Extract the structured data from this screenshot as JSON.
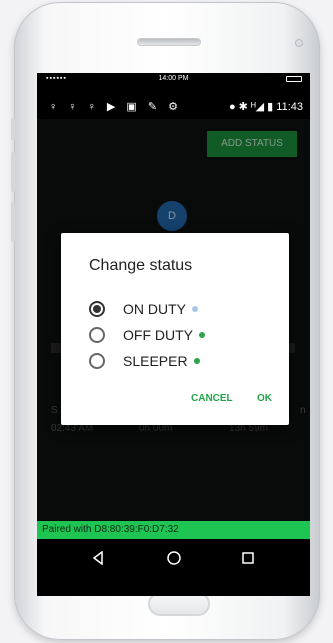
{
  "system_bar": {
    "signal": "▪▪▪▪▪▪",
    "time": "14:00 PM"
  },
  "status_bar": {
    "left_icons": "♀ ♀ ♀ ▶ ▣ ✎ ⚙",
    "right_text": "● ✱ ᴴ◢ ▮ 11:43"
  },
  "app": {
    "add_status_label": "ADD STATUS",
    "avatar_letter": "D",
    "bg_text_1": "S",
    "bg_time_1": "02:43 AM",
    "bg_time_2": "0h 00m",
    "bg_time_3": "13h 59m",
    "bg_text_right": "n"
  },
  "dialog": {
    "title": "Change status",
    "options": [
      {
        "label": "ON DUTY",
        "selected": true,
        "dot_color": "#a8c9e6"
      },
      {
        "label": "OFF DUTY",
        "selected": false,
        "dot_color": "#2aa34a"
      },
      {
        "label": "SLEEPER",
        "selected": false,
        "dot_color": "#2aa34a"
      }
    ],
    "cancel_label": "CANCEL",
    "ok_label": "OK"
  },
  "paired_text": "Paired with D8:80:39:F0:D7:32",
  "nav_icons": [
    "back-icon",
    "home-icon",
    "recents-icon"
  ],
  "colors": {
    "accent_green": "#1fc552",
    "button_green": "#1a8c3b",
    "avatar_blue": "#1f66a8"
  }
}
